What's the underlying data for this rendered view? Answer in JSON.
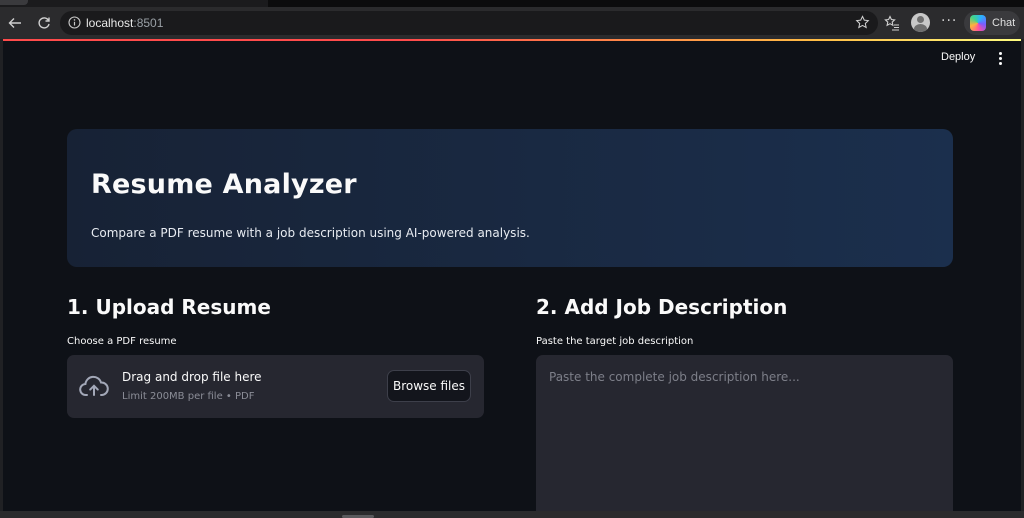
{
  "browser": {
    "url_host": "localhost",
    "url_port": ":8501",
    "chat_label": "Chat"
  },
  "app": {
    "deploy_label": "Deploy",
    "hero": {
      "title": "Resume Analyzer",
      "subtitle": "Compare a PDF resume with a job description using AI-powered analysis."
    },
    "upload_section": {
      "title": "1. Upload Resume",
      "field_label": "Choose a PDF resume",
      "dropzone_title": "Drag and drop file here",
      "dropzone_sub": "Limit 200MB per file • PDF",
      "browse_label": "Browse files"
    },
    "job_section": {
      "title": "2. Add Job Description",
      "field_label": "Paste the target job description",
      "placeholder": "Paste the complete job description here..."
    }
  },
  "colors": {
    "background": "#0e1117",
    "hero_start": "#172235",
    "hero_end": "#1b2f4d",
    "widget_bg": "#262730",
    "accent_red": "#ff4b4b"
  }
}
